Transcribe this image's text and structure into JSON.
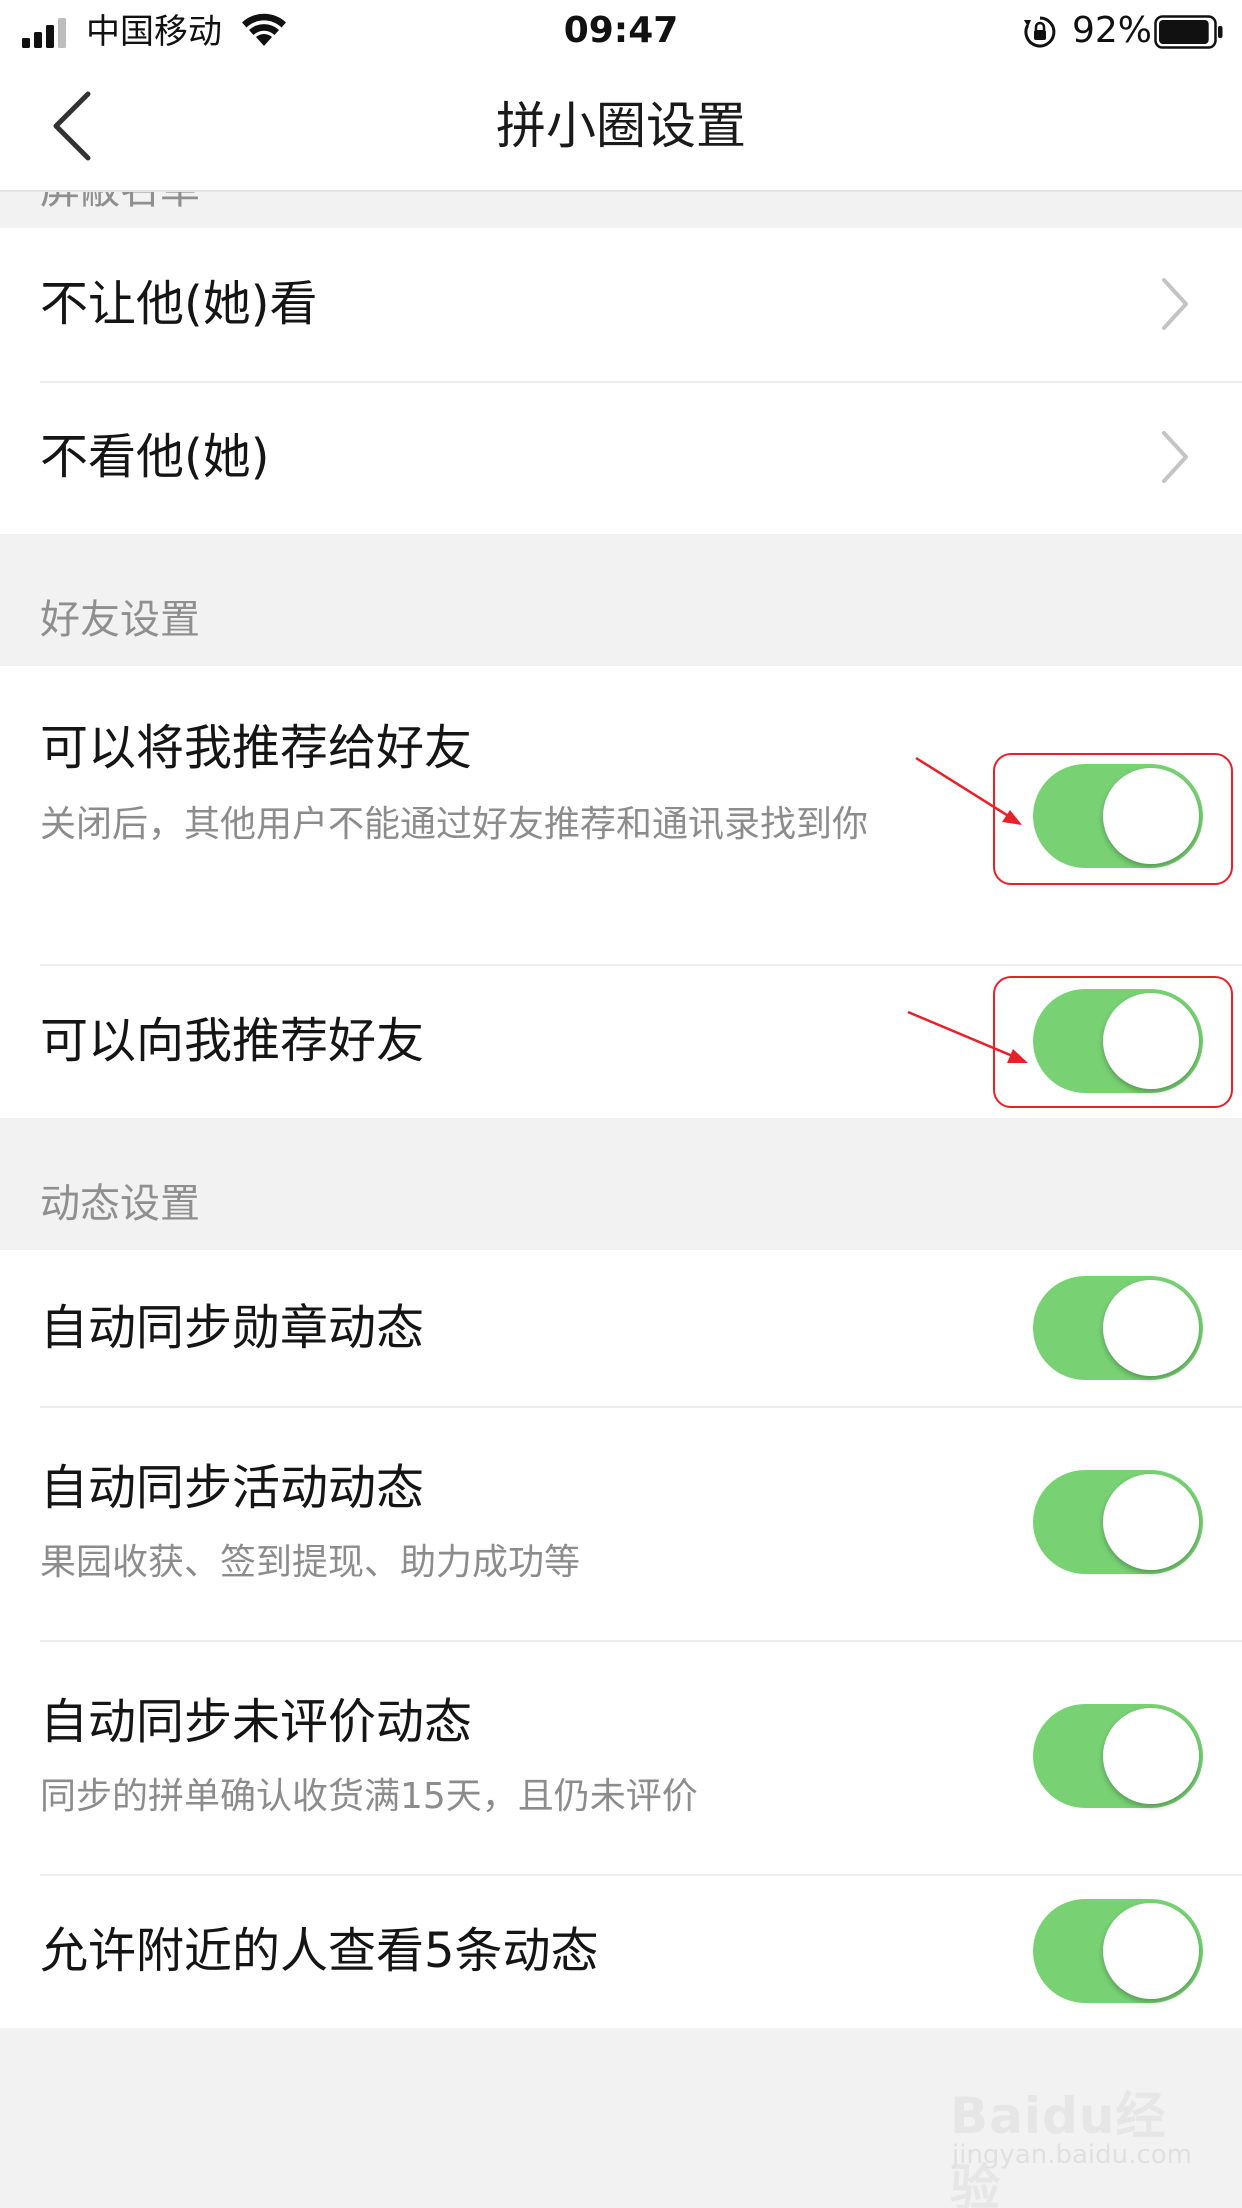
{
  "status_bar": {
    "carrier": "中国移动",
    "time": "09:47",
    "battery": "92%",
    "battery_level": 0.92
  },
  "nav": {
    "title": "拼小圈设置"
  },
  "clipped_section_label": "屏蔽名单",
  "block_list": {
    "items": [
      {
        "label": "不让他(她)看"
      },
      {
        "label": "不看他(她)"
      }
    ]
  },
  "friend_settings": {
    "header": "好友设置",
    "items": [
      {
        "label": "可以将我推荐给好友",
        "desc": "关闭后，其他用户不能通过好友推荐和通讯录找到你",
        "on": true
      },
      {
        "label": "可以向我推荐好友",
        "on": true
      }
    ]
  },
  "feed_settings": {
    "header": "动态设置",
    "items": [
      {
        "label": "自动同步勋章动态",
        "on": true
      },
      {
        "label": "自动同步活动动态",
        "desc": "果园收获、签到提现、助力成功等",
        "on": true
      },
      {
        "label": "自动同步未评价动态",
        "desc": "同步的拼单确认收货满15天，且仍未评价",
        "on": true
      },
      {
        "label": "允许附近的人查看5条动态",
        "on": true
      }
    ]
  },
  "colors": {
    "toggle_on": "#78d274",
    "annotation": "#e8202a"
  },
  "watermark": {
    "text": "Baidu经验",
    "sub": "jingyan.baidu.com"
  }
}
